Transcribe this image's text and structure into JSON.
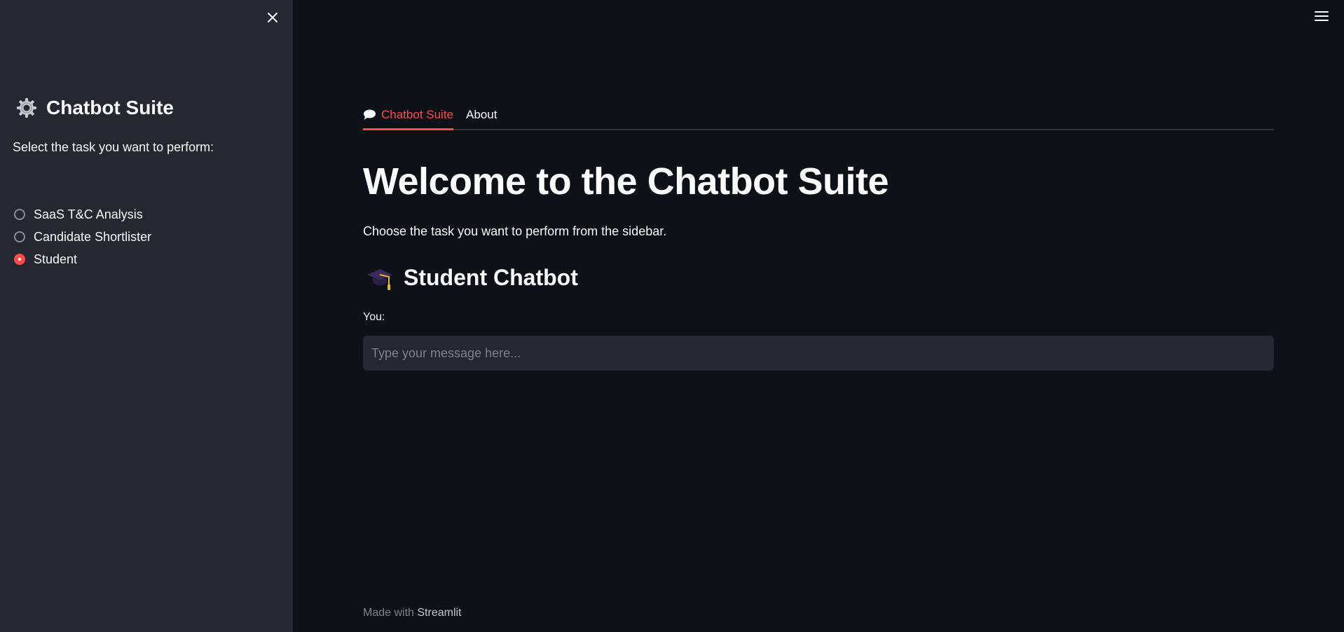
{
  "sidebar": {
    "title": "Chatbot Suite",
    "title_icon": "gear-icon",
    "prompt": "Select the task you want to perform:",
    "options": [
      {
        "label": "SaaS T&C Analysis",
        "selected": false
      },
      {
        "label": "Candidate Shortlister",
        "selected": false
      },
      {
        "label": "Student",
        "selected": true
      }
    ],
    "close_icon": "close-icon"
  },
  "header": {
    "menu_icon": "hamburger-menu-icon"
  },
  "tabs": [
    {
      "label": "Chatbot Suite",
      "icon": "speech-bubble-icon",
      "active": true
    },
    {
      "label": "About",
      "active": false
    }
  ],
  "main": {
    "title": "Welcome to the Chatbot Suite",
    "subtitle": "Choose the task you want to perform from the sidebar.",
    "section_title": "Student Chatbot",
    "section_icon": "graduation-cap-icon",
    "input_label": "You:",
    "input_placeholder": "Type your message here...",
    "input_value": ""
  },
  "footer": {
    "prefix": "Made with",
    "brand": "Streamlit"
  },
  "colors": {
    "background": "#0e1117",
    "sidebar": "#262730",
    "accent": "#ff4b4b",
    "text": "#fafafa",
    "muted": "#7f828b"
  }
}
